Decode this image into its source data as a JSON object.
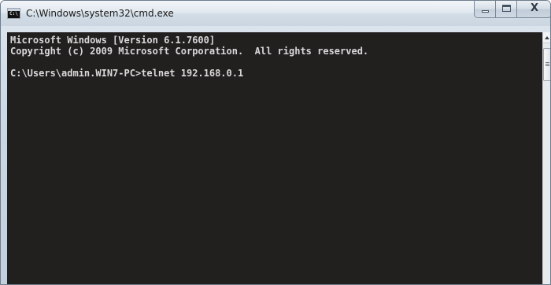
{
  "window": {
    "title": "C:\\Windows\\system32\\cmd.exe",
    "icon": "cmd-icon",
    "icon_glyph": "C:\\",
    "buttons": {
      "minimize_icon": "minimize-icon",
      "maximize_icon": "maximize-icon",
      "close_icon": "close-icon",
      "close_glyph": "X"
    }
  },
  "console": {
    "lines": [
      "Microsoft Windows [Version 6.1.7600]",
      "Copyright (c) 2009 Microsoft Corporation.  All rights reserved.",
      "C:\\Users\\admin.WIN7-PC>telnet 192.168.0.1"
    ],
    "background_color": "#221f1f",
    "text_color": "#d9d9d9"
  }
}
